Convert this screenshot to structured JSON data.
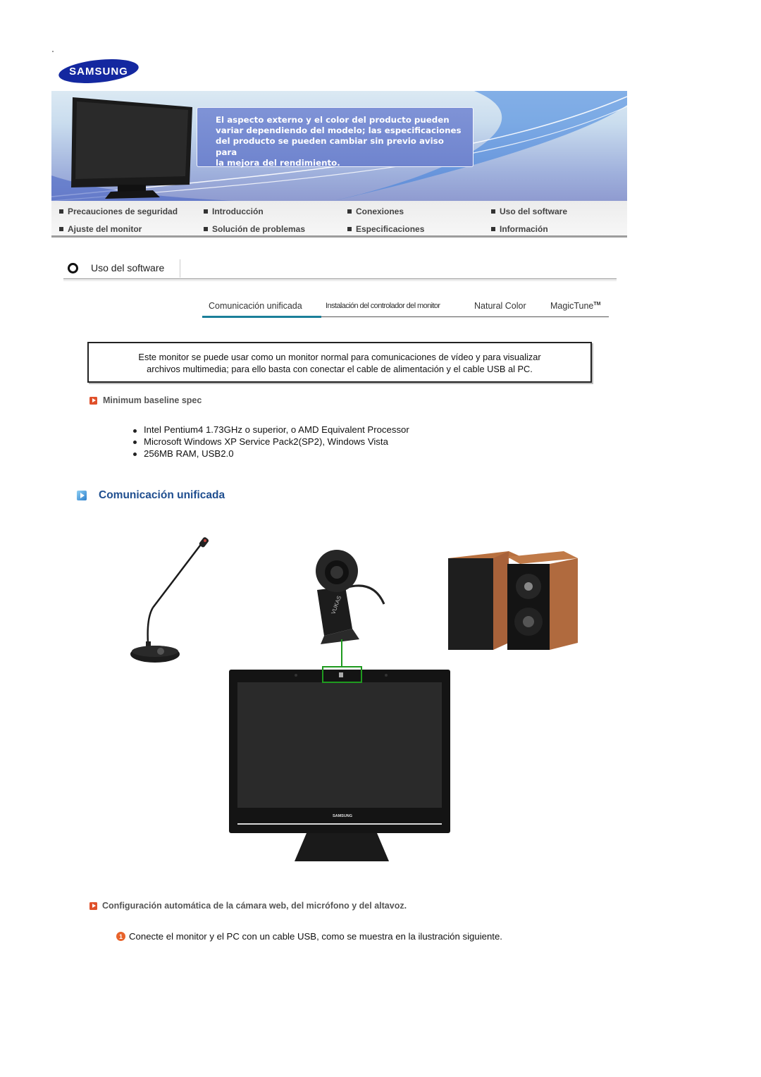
{
  "brand": {
    "logo_text": "SAMSUNG",
    "logo_color": "#1428a0"
  },
  "banner": {
    "notice_lines": [
      "El aspecto externo y el color del producto pueden",
      "variar dependiendo del modelo; las especificaciones",
      "del producto se pueden cambiar sin previo aviso para",
      "la mejora del rendimiento."
    ]
  },
  "nav": {
    "items": [
      {
        "label": "Precauciones de seguridad"
      },
      {
        "label": "Introducción"
      },
      {
        "label": "Conexiones"
      },
      {
        "label": "Uso del software"
      },
      {
        "label": "Ajuste del monitor"
      },
      {
        "label": "Solución de problemas"
      },
      {
        "label": "Especificaciones"
      },
      {
        "label": "Información"
      }
    ]
  },
  "section": {
    "title": "Uso del software"
  },
  "subtabs": {
    "items": [
      {
        "label": "Comunicación unificada",
        "active": true
      },
      {
        "label": "Instalación del controlador del monitor",
        "active": false
      },
      {
        "label": "Natural Color",
        "active": false
      },
      {
        "label": "MagicTune",
        "suffix": "TM",
        "active": false
      }
    ],
    "active_color": "#1b7f9a"
  },
  "intro": {
    "lines": [
      "Este monitor se puede usar como un monitor normal para comunicaciones de vídeo y para visualizar",
      "archivos multimedia; para ello basta con conectar el cable de alimentación y el cable USB al PC."
    ]
  },
  "min_spec": {
    "heading": "Minimum baseline spec",
    "items": [
      "Intel Pentium4 1.73GHz o superior, o AMD Equivalent Processor",
      "Microsoft Windows XP Service Pack2(SP2), Windows Vista",
      "256MB RAM, USB2.0"
    ]
  },
  "unified": {
    "heading": "Comunicación unificada",
    "heading_color": "#1f4e8f",
    "illustration": {
      "devices": [
        "microphone",
        "webcam",
        "speakers",
        "monitor"
      ],
      "monitor_logo": "SAMSUNG",
      "webcam_label": "VUKAS",
      "highlight_color": "#1f9a1f"
    }
  },
  "config": {
    "heading": "Configuración automática de la cámara web, del micrófono y del altavoz.",
    "steps": [
      {
        "num": "1",
        "text": "Conecte el monitor y el PC con un cable USB, como se muestra en la ilustración siguiente."
      }
    ]
  },
  "colors": {
    "accent_orange": "#e0502a"
  }
}
